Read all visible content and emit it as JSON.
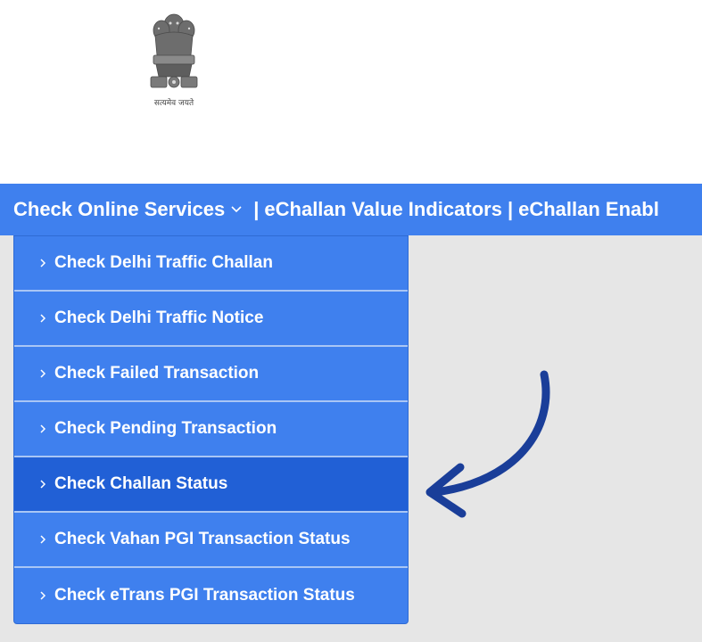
{
  "header": {
    "emblem_icon": "national-emblem-icon",
    "emblem_caption": "सत्यमेव जयते"
  },
  "navbar": {
    "background": "#3f80ee",
    "items": [
      {
        "label": "Check Online Services",
        "has_caret": true
      },
      {
        "label": "eChallan Value Indicators"
      },
      {
        "label": "eChallan Enabl"
      }
    ],
    "separator": "|"
  },
  "dropdown": {
    "chevron_icon": "chevron-right-icon",
    "active_background": "#2160d6",
    "items": [
      {
        "label": "Check Delhi Traffic Challan"
      },
      {
        "label": "Check Delhi Traffic Notice"
      },
      {
        "label": "Check Failed Transaction"
      },
      {
        "label": "Check Pending Transaction"
      },
      {
        "label": "Check Challan Status",
        "highlighted": true
      },
      {
        "label": "Check Vahan PGI Transaction Status"
      },
      {
        "label": "Check eTrans PGI Transaction Status"
      }
    ]
  },
  "annotation": {
    "arrow_icon": "curved-arrow-icon",
    "arrow_color": "#1a3e99"
  }
}
